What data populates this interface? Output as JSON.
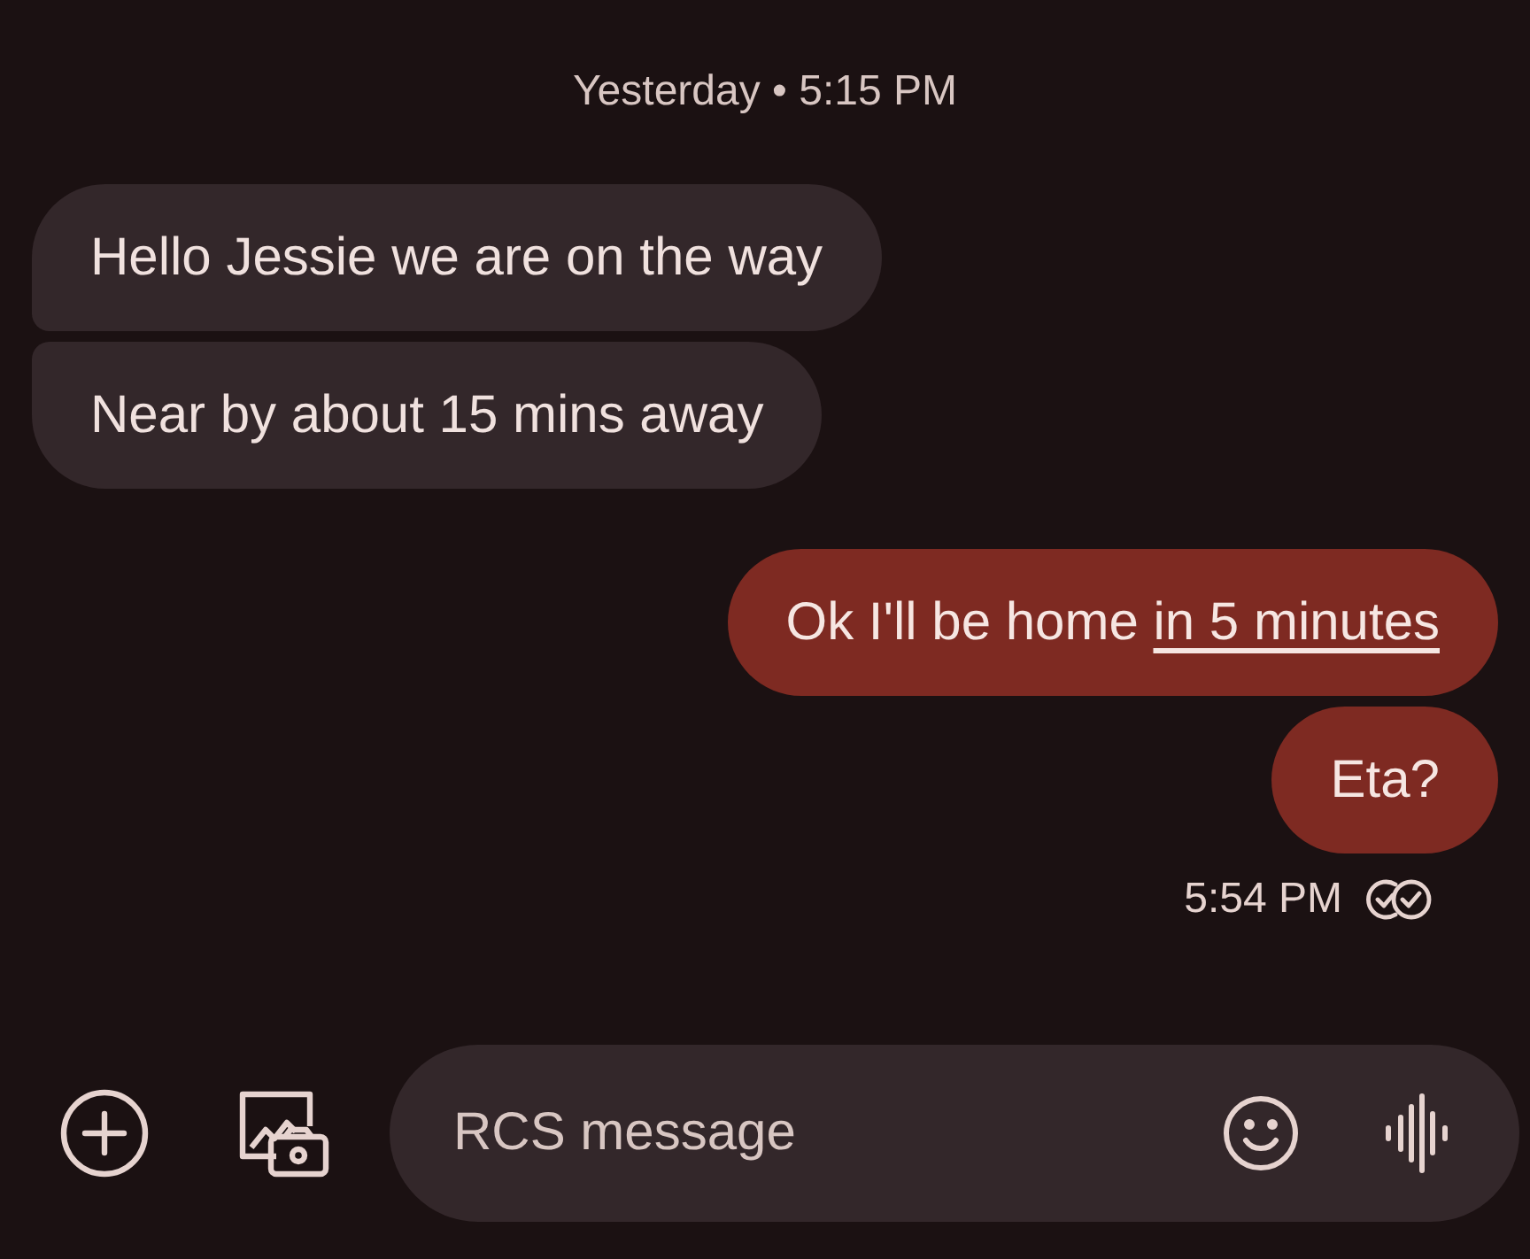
{
  "date_header": {
    "day": "Yesterday",
    "separator": "•",
    "time": "5:15 PM"
  },
  "messages": [
    {
      "kind": "incoming",
      "text": "Hello Jessie we are on the way"
    },
    {
      "kind": "incoming",
      "text": "Near by about 15 mins away"
    },
    {
      "kind": "outgoing",
      "text": "Ok I'll be home ",
      "link": "in 5 minutes"
    },
    {
      "kind": "outgoing",
      "text": "Eta?"
    }
  ],
  "last_sent_time": "5:54 PM",
  "composer": {
    "placeholder": "RCS message"
  }
}
